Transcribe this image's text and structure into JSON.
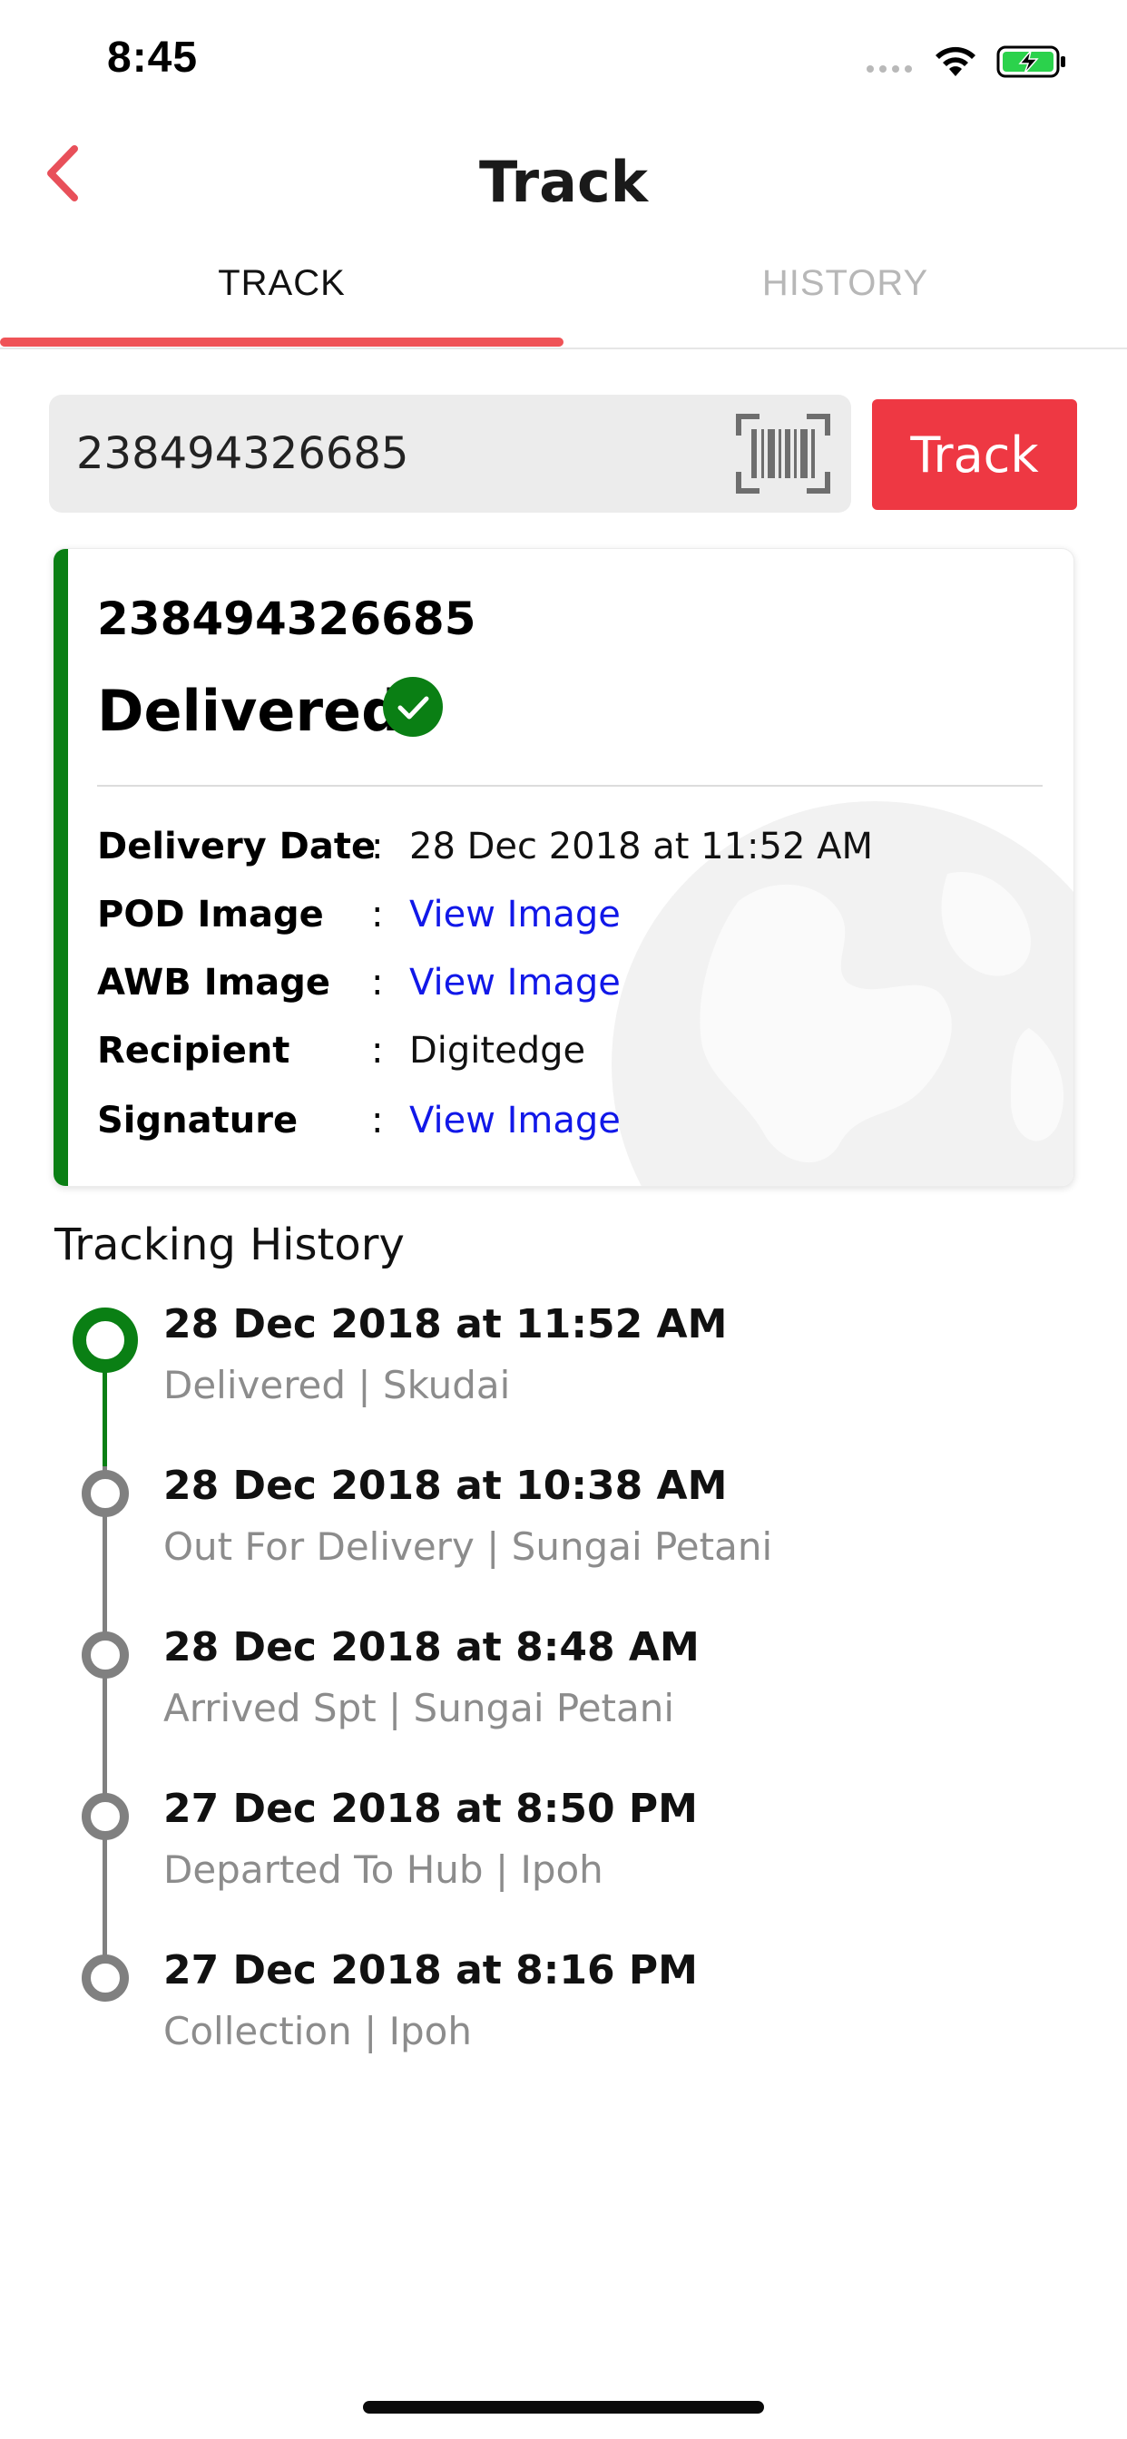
{
  "status_bar": {
    "time": "8:45"
  },
  "nav": {
    "title": "Track"
  },
  "tabs": [
    {
      "label": "TRACK",
      "active": true
    },
    {
      "label": "HISTORY",
      "active": false
    }
  ],
  "search": {
    "value": "238494326685",
    "button_label": "Track"
  },
  "result": {
    "awb": "238494326685",
    "status": "Delivered",
    "details": [
      {
        "label": "Delivery Date",
        "colon": ":",
        "value": "28 Dec 2018  at 11:52 AM"
      },
      {
        "label": "POD Image",
        "colon": ":",
        "value": "View Image"
      },
      {
        "label": "AWB Image",
        "colon": ":",
        "value": "View Image"
      },
      {
        "label": "Recipient",
        "colon": ":",
        "value": "Digitedge"
      },
      {
        "label": "Signature",
        "colon": ":",
        "value": "View Image"
      }
    ]
  },
  "history": {
    "title": "Tracking History",
    "events": [
      {
        "date": "28 Dec 2018  at 11:52 AM",
        "description": "Delivered | Skudai"
      },
      {
        "date": "28 Dec 2018  at 10:38 AM",
        "description": "Out For Delivery | Sungai Petani"
      },
      {
        "date": "28 Dec 2018  at 8:48 AM",
        "description": "Arrived Spt | Sungai Petani"
      },
      {
        "date": "27 Dec 2018  at 8:50 PM",
        "description": "Departed To Hub | Ipoh"
      },
      {
        "date": "27 Dec 2018  at 8:16 PM",
        "description": "Collection | Ipoh"
      }
    ]
  },
  "colors": {
    "accent_red": "#ee3843",
    "tab_indicator": "#ef5357",
    "delivered_green": "#0a7f14",
    "link_blue": "#1118e8",
    "timeline_gray": "#808080"
  }
}
